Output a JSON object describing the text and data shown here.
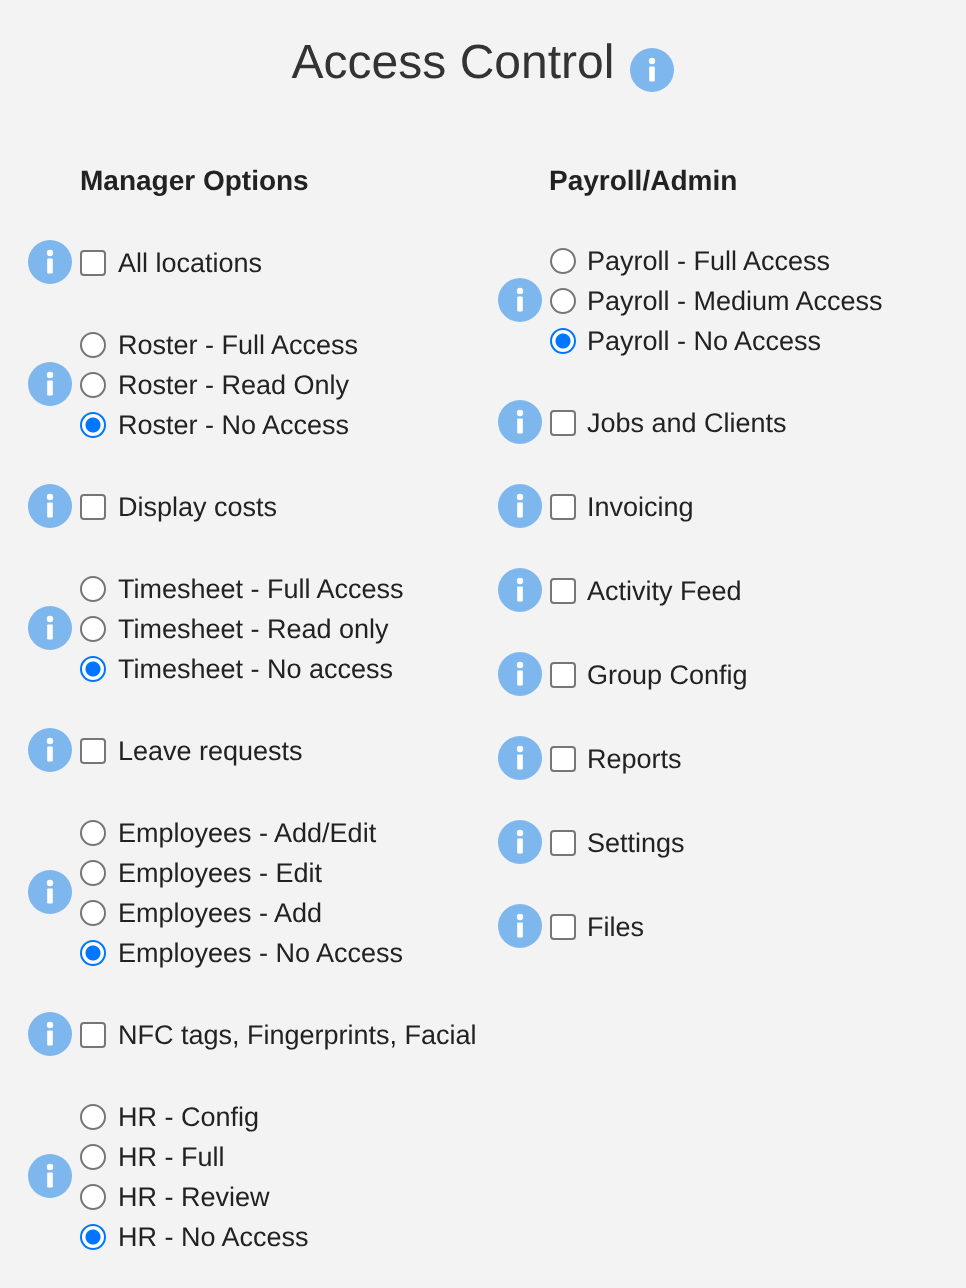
{
  "title": "Access Control",
  "columns": [
    {
      "heading": "Manager Options",
      "groups": [
        {
          "kind": "checkbox",
          "label": "All locations",
          "checked": false
        },
        {
          "kind": "radio",
          "options": [
            {
              "label": "Roster - Full Access",
              "selected": false
            },
            {
              "label": "Roster - Read Only",
              "selected": false
            },
            {
              "label": "Roster - No Access",
              "selected": true
            }
          ]
        },
        {
          "kind": "checkbox",
          "label": "Display costs",
          "checked": false
        },
        {
          "kind": "radio",
          "options": [
            {
              "label": "Timesheet - Full Access",
              "selected": false
            },
            {
              "label": "Timesheet - Read only",
              "selected": false
            },
            {
              "label": "Timesheet - No access",
              "selected": true
            }
          ]
        },
        {
          "kind": "checkbox",
          "label": "Leave requests",
          "checked": false
        },
        {
          "kind": "radio",
          "options": [
            {
              "label": "Employees - Add/Edit",
              "selected": false
            },
            {
              "label": "Employees - Edit",
              "selected": false
            },
            {
              "label": "Employees - Add",
              "selected": false
            },
            {
              "label": "Employees - No Access",
              "selected": true
            }
          ]
        },
        {
          "kind": "checkbox",
          "label": "NFC tags, Fingerprints, Facial",
          "checked": false
        },
        {
          "kind": "radio",
          "options": [
            {
              "label": "HR - Config",
              "selected": false
            },
            {
              "label": "HR - Full",
              "selected": false
            },
            {
              "label": "HR - Review",
              "selected": false
            },
            {
              "label": "HR - No Access",
              "selected": true
            }
          ]
        }
      ]
    },
    {
      "heading": "Payroll/Admin",
      "groups": [
        {
          "kind": "radio",
          "options": [
            {
              "label": "Payroll - Full Access",
              "selected": false
            },
            {
              "label": "Payroll - Medium Access",
              "selected": false
            },
            {
              "label": "Payroll - No Access",
              "selected": true
            }
          ]
        },
        {
          "kind": "checkbox",
          "label": "Jobs and Clients",
          "checked": false
        },
        {
          "kind": "checkbox",
          "label": "Invoicing",
          "checked": false
        },
        {
          "kind": "checkbox",
          "label": "Activity Feed",
          "checked": false
        },
        {
          "kind": "checkbox",
          "label": "Group Config",
          "checked": false
        },
        {
          "kind": "checkbox",
          "label": "Reports",
          "checked": false
        },
        {
          "kind": "checkbox",
          "label": "Settings",
          "checked": false
        },
        {
          "kind": "checkbox",
          "label": "Files",
          "checked": false
        }
      ]
    }
  ]
}
